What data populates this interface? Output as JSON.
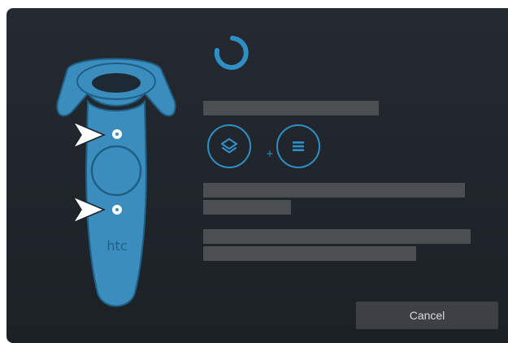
{
  "dialog": {
    "controller": {
      "brand": "htc"
    },
    "buttons": {
      "layers_icon": "layers-icon",
      "plus": "+",
      "menu_icon": "menu-icon"
    },
    "cancel_label": "Cancel"
  },
  "colors": {
    "accent": "#2f8fc5",
    "controller_body": "#3a8dbd",
    "background": "#20262b",
    "button_bg": "#3d4146"
  }
}
